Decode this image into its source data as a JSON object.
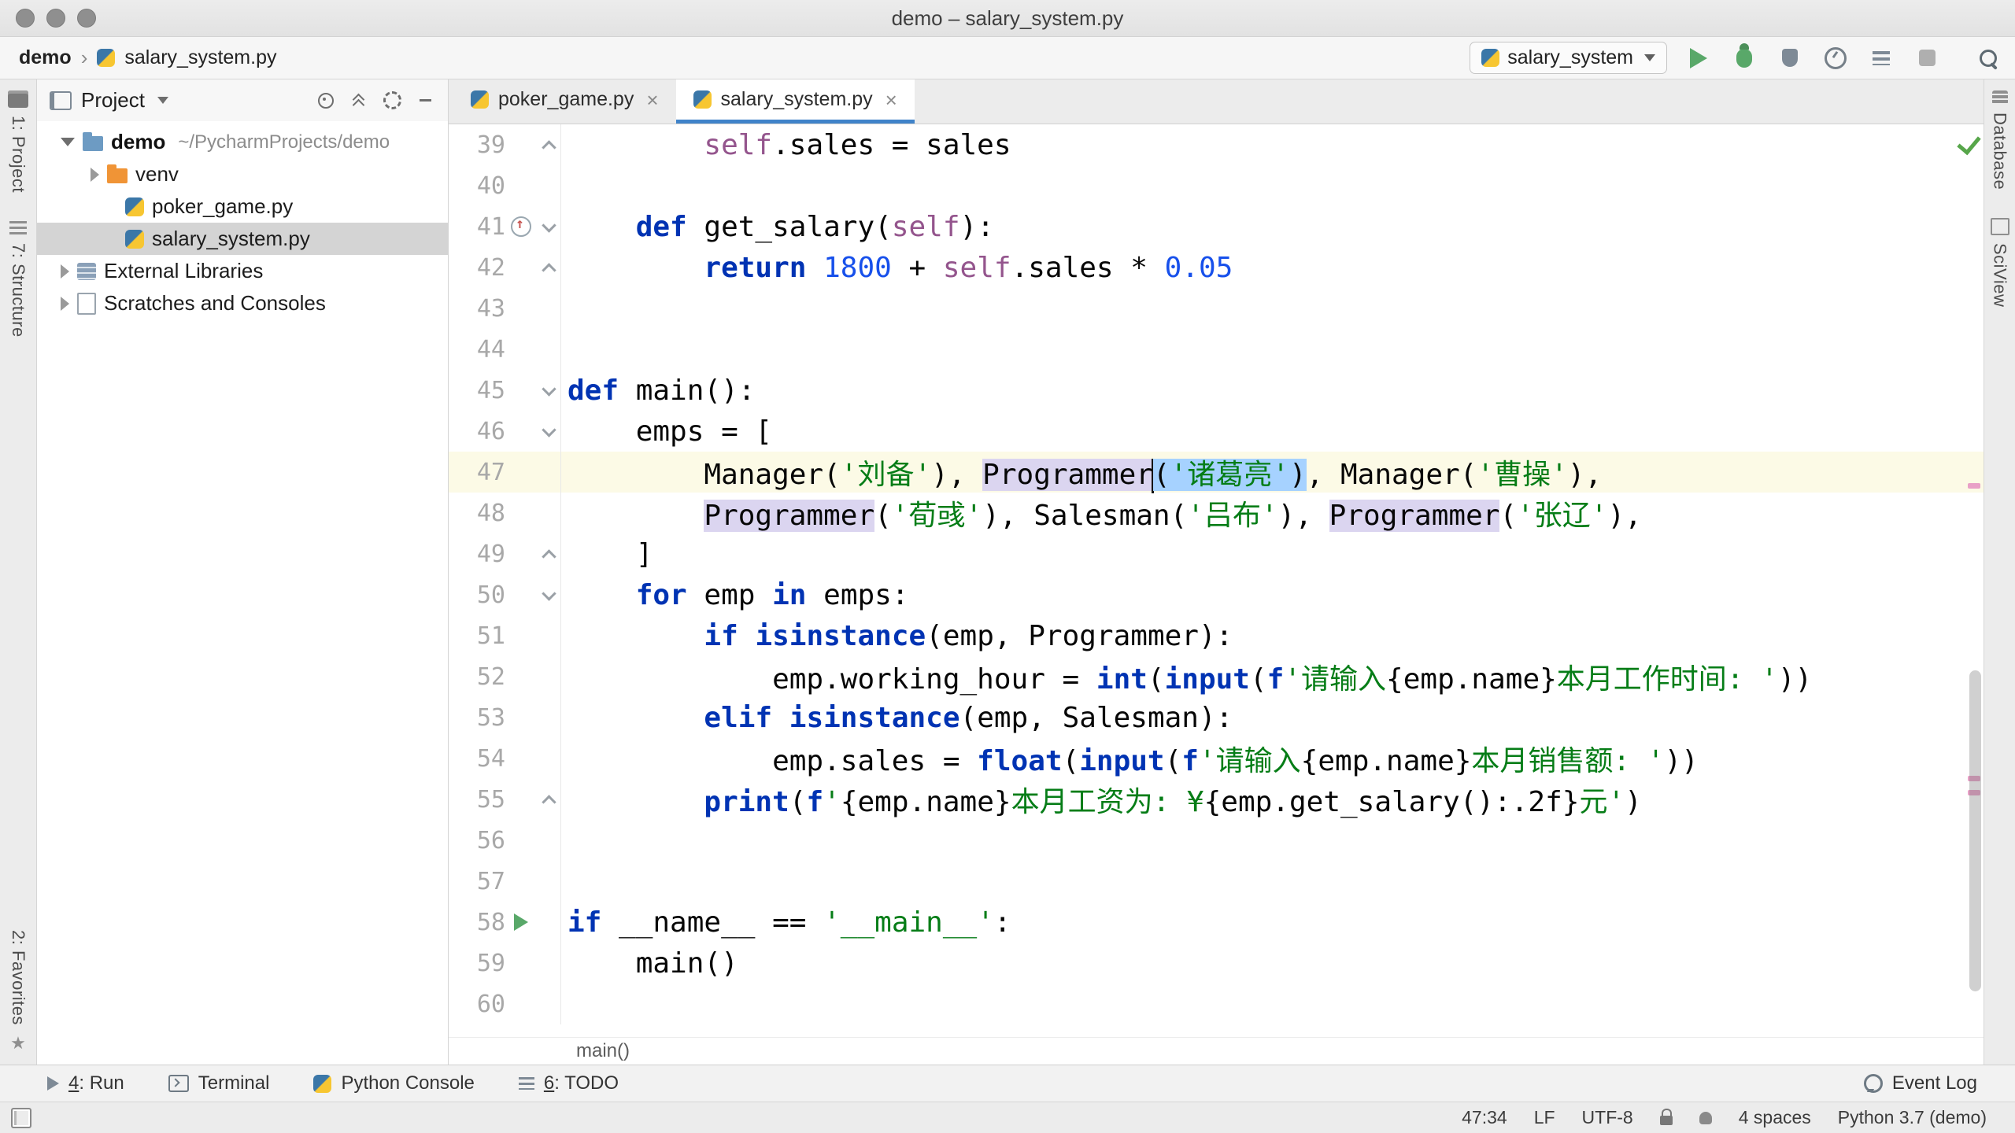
{
  "window": {
    "title": "demo – salary_system.py"
  },
  "navbar": {
    "breadcrumbs": [
      "demo",
      "salary_system.py"
    ],
    "run_config": "salary_system"
  },
  "tool_strips": {
    "left": [
      {
        "label": "1: Project"
      },
      {
        "label": "7: Structure"
      },
      {
        "label": "2: Favorites"
      }
    ],
    "right": [
      {
        "label": "Database"
      },
      {
        "label": "SciView"
      }
    ]
  },
  "project_panel": {
    "header": {
      "title": "Project"
    },
    "tree": [
      {
        "label": "demo",
        "path": "~/PycharmProjects/demo",
        "type": "project-folder"
      },
      {
        "label": "venv",
        "type": "excluded-folder"
      },
      {
        "label": "poker_game.py",
        "type": "python-file"
      },
      {
        "label": "salary_system.py",
        "type": "python-file",
        "selected": true
      },
      {
        "label": "External Libraries",
        "type": "libraries"
      },
      {
        "label": "Scratches and Consoles",
        "type": "scratches"
      }
    ]
  },
  "tabs": [
    {
      "label": "poker_game.py"
    },
    {
      "label": "salary_system.py",
      "active": true
    }
  ],
  "editor": {
    "breadcrumb": "main()",
    "lines": [
      {
        "num": 39,
        "fold": "up",
        "segs": [
          {
            "t": "        "
          },
          {
            "t": "self",
            "c": "self"
          },
          {
            "t": ".sales = sales"
          }
        ]
      },
      {
        "num": 40,
        "segs": []
      },
      {
        "num": 41,
        "fold": "down",
        "icon": "override",
        "segs": [
          {
            "t": "    "
          },
          {
            "t": "def",
            "c": "kw"
          },
          {
            "t": " get_salary("
          },
          {
            "t": "self",
            "c": "self"
          },
          {
            "t": "):"
          }
        ]
      },
      {
        "num": 42,
        "fold": "up",
        "segs": [
          {
            "t": "        "
          },
          {
            "t": "return",
            "c": "kw"
          },
          {
            "t": " "
          },
          {
            "t": "1800",
            "c": "num"
          },
          {
            "t": " + "
          },
          {
            "t": "self",
            "c": "self"
          },
          {
            "t": ".sales * "
          },
          {
            "t": "0.05",
            "c": "num"
          }
        ]
      },
      {
        "num": 43,
        "segs": []
      },
      {
        "num": 44,
        "segs": []
      },
      {
        "num": 45,
        "fold": "down",
        "segs": [
          {
            "t": "def",
            "c": "kw"
          },
          {
            "t": " main():"
          }
        ]
      },
      {
        "num": 46,
        "fold": "down",
        "segs": [
          {
            "t": "    emps = ["
          }
        ]
      },
      {
        "num": 47,
        "current": true,
        "segs": [
          {
            "t": "        Manager("
          },
          {
            "t": "'刘备'",
            "c": "str"
          },
          {
            "t": "), "
          },
          {
            "t": "Programmer",
            "c": "hl"
          },
          {
            "t": "",
            "c": "caret"
          },
          {
            "t": "(",
            "c": "sel"
          },
          {
            "t": "'诸葛亮'",
            "c": "str sel"
          },
          {
            "t": ")",
            "c": "sel"
          },
          {
            "t": ", Manager("
          },
          {
            "t": "'曹操'",
            "c": "str"
          },
          {
            "t": "),"
          }
        ]
      },
      {
        "num": 48,
        "segs": [
          {
            "t": "        "
          },
          {
            "t": "Programmer",
            "c": "hl"
          },
          {
            "t": "("
          },
          {
            "t": "'荀彧'",
            "c": "str"
          },
          {
            "t": "), Salesman("
          },
          {
            "t": "'吕布'",
            "c": "str"
          },
          {
            "t": "), "
          },
          {
            "t": "Programmer",
            "c": "hl"
          },
          {
            "t": "("
          },
          {
            "t": "'张辽'",
            "c": "str"
          },
          {
            "t": "),"
          }
        ]
      },
      {
        "num": 49,
        "fold": "up",
        "segs": [
          {
            "t": "    ]"
          }
        ]
      },
      {
        "num": 50,
        "fold": "down",
        "segs": [
          {
            "t": "    "
          },
          {
            "t": "for",
            "c": "kw"
          },
          {
            "t": " emp "
          },
          {
            "t": "in",
            "c": "kw"
          },
          {
            "t": " emps:"
          }
        ]
      },
      {
        "num": 51,
        "segs": [
          {
            "t": "        "
          },
          {
            "t": "if",
            "c": "kw"
          },
          {
            "t": " "
          },
          {
            "t": "isinstance",
            "c": "kw"
          },
          {
            "t": "(emp, Programmer):"
          }
        ]
      },
      {
        "num": 52,
        "segs": [
          {
            "t": "            emp.working_hour = "
          },
          {
            "t": "int",
            "c": "kw"
          },
          {
            "t": "("
          },
          {
            "t": "input",
            "c": "kw"
          },
          {
            "t": "("
          },
          {
            "t": "f",
            "c": "kw"
          },
          {
            "t": "'请输入",
            "c": "str"
          },
          {
            "t": "{emp.name}"
          },
          {
            "t": "本月工作时间: '",
            "c": "str"
          },
          {
            "t": "))"
          }
        ]
      },
      {
        "num": 53,
        "segs": [
          {
            "t": "        "
          },
          {
            "t": "elif",
            "c": "kw"
          },
          {
            "t": " "
          },
          {
            "t": "isinstance",
            "c": "kw"
          },
          {
            "t": "(emp, Salesman):"
          }
        ]
      },
      {
        "num": 54,
        "segs": [
          {
            "t": "            emp.sales = "
          },
          {
            "t": "float",
            "c": "kw"
          },
          {
            "t": "("
          },
          {
            "t": "input",
            "c": "kw"
          },
          {
            "t": "("
          },
          {
            "t": "f",
            "c": "kw"
          },
          {
            "t": "'请输入",
            "c": "str"
          },
          {
            "t": "{emp.name}"
          },
          {
            "t": "本月销售额: '",
            "c": "str"
          },
          {
            "t": "))"
          }
        ]
      },
      {
        "num": 55,
        "fold": "up",
        "segs": [
          {
            "t": "        "
          },
          {
            "t": "print",
            "c": "kw"
          },
          {
            "t": "("
          },
          {
            "t": "f",
            "c": "kw"
          },
          {
            "t": "'",
            "c": "str"
          },
          {
            "t": "{emp.name}"
          },
          {
            "t": "本月工资为: ¥",
            "c": "str"
          },
          {
            "t": "{emp.get_salary():.2f}"
          },
          {
            "t": "元'",
            "c": "str"
          },
          {
            "t": ")"
          }
        ]
      },
      {
        "num": 56,
        "segs": []
      },
      {
        "num": 57,
        "segs": []
      },
      {
        "num": 58,
        "icon": "run",
        "segs": [
          {
            "t": "if",
            "c": "kw"
          },
          {
            "t": " __name__ == "
          },
          {
            "t": "'__main__'",
            "c": "str"
          },
          {
            "t": ":"
          }
        ]
      },
      {
        "num": 59,
        "segs": [
          {
            "t": "    main()"
          }
        ]
      },
      {
        "num": 60,
        "segs": []
      }
    ]
  },
  "toolrow": {
    "left": [
      {
        "mnemonic": "4",
        "label": ": Run"
      },
      {
        "mnemonic": "",
        "label": "Terminal"
      },
      {
        "mnemonic": "",
        "label": "Python Console"
      },
      {
        "mnemonic": "6",
        "label": ": TODO"
      }
    ],
    "right": [
      {
        "label": "Event Log"
      }
    ]
  },
  "statusbar": {
    "caret": "47:34",
    "line_sep": "LF",
    "encoding": "UTF-8",
    "indent": "4 spaces",
    "interpreter": "Python 3.7 (demo)"
  }
}
